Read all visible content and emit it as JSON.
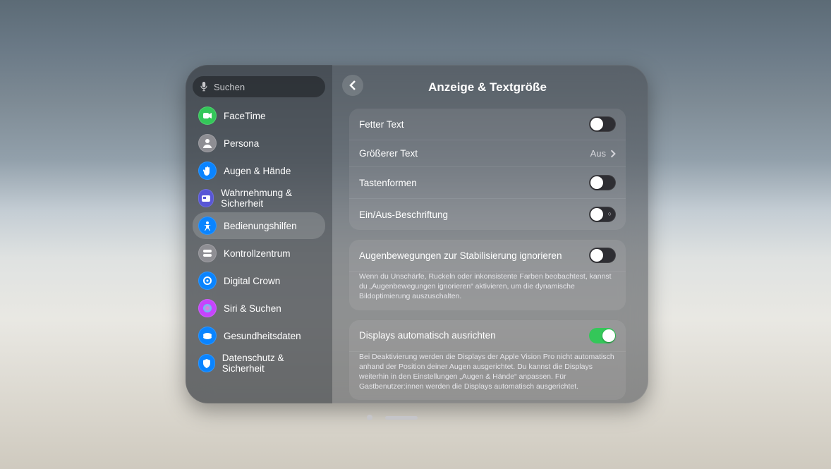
{
  "search": {
    "placeholder": "Suchen"
  },
  "sidebar": {
    "items": [
      {
        "label": "FaceTime",
        "color": "#34c759",
        "icon": "video",
        "selected": false
      },
      {
        "label": "Persona",
        "color": "#8e8e93",
        "icon": "person",
        "selected": false
      },
      {
        "label": "Augen & Hände",
        "color": "#0a84ff",
        "icon": "hand",
        "selected": false
      },
      {
        "label": "Wahrnehmung & Sicherheit",
        "color": "#5856d6",
        "icon": "badge",
        "selected": false
      },
      {
        "label": "Bedienungshilfen",
        "color": "#0a84ff",
        "icon": "accessibility",
        "selected": true
      },
      {
        "label": "Kontrollzentrum",
        "color": "#8e8e93",
        "icon": "switches",
        "selected": false
      },
      {
        "label": "Digital Crown",
        "color": "#0a84ff",
        "icon": "crown",
        "selected": false
      },
      {
        "label": "Siri & Suchen",
        "color": "#c644fc",
        "icon": "siri",
        "selected": false
      },
      {
        "label": "Gesundheitsdaten",
        "color": "#0a84ff",
        "icon": "health",
        "selected": false
      },
      {
        "label": "Datenschutz & Sicherheit",
        "color": "#0a84ff",
        "icon": "shield",
        "selected": false
      }
    ]
  },
  "page": {
    "title": "Anzeige & Textgröße",
    "groups": [
      {
        "rows": [
          {
            "kind": "toggle",
            "label": "Fetter Text",
            "on": false
          },
          {
            "kind": "link",
            "label": "Größerer Text",
            "value": "Aus"
          },
          {
            "kind": "toggle",
            "label": "Tastenformen",
            "on": false
          },
          {
            "kind": "toggle",
            "label": "Ein/Aus-Beschriftung",
            "on": false,
            "showOnOff": true
          }
        ]
      },
      {
        "rows": [
          {
            "kind": "toggle",
            "label": "Augenbewegungen zur Stabilisierung ignorieren",
            "on": false
          }
        ],
        "footer": "Wenn du Unschärfe, Ruckeln oder inkonsistente Farben beobachtest, kannst du „Augenbewegungen ignorieren“ aktivieren, um die dynamische Bildoptimierung auszuschalten."
      },
      {
        "rows": [
          {
            "kind": "toggle",
            "label": "Displays automatisch ausrichten",
            "on": true
          }
        ],
        "footer": "Bei Deaktivierung werden die Displays der Apple Vision Pro nicht automatisch anhand der Position deiner Augen ausgerichtet. Du kannst die Displays weiterhin in den Einstellungen „Augen & Hände“ anpassen. Für Gastbenutzer:innen werden die Displays automatisch ausgerichtet."
      }
    ]
  }
}
